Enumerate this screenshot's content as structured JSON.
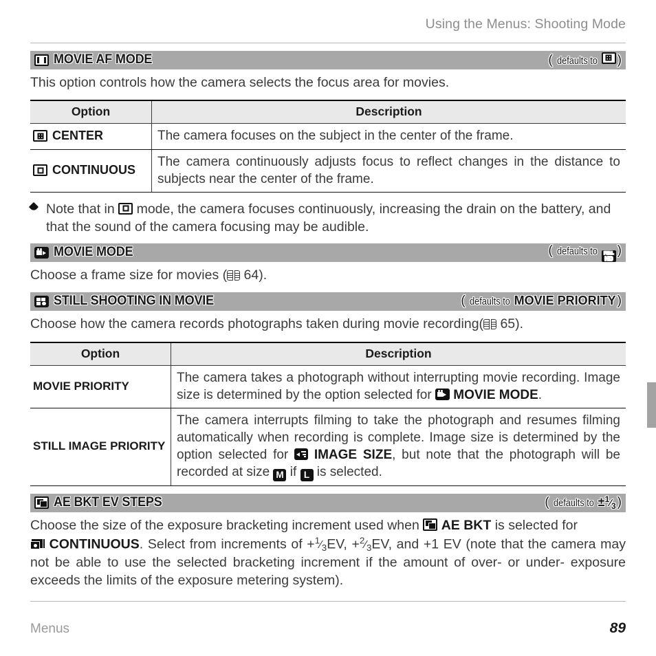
{
  "header": {
    "running_title": "Using the Menus: Shooting Mode"
  },
  "sections": {
    "movie_af": {
      "icon": "movie-af-mode-icon",
      "title": "MOVIE AF MODE",
      "defaults_prefix": "(",
      "defaults_label": "defaults to ",
      "defaults_icon": "center-af-icon",
      "defaults_suffix": ")",
      "intro": "This option controls how the camera selects the focus area for movies.",
      "table": {
        "headers": [
          "Option",
          "Description"
        ],
        "rows": [
          {
            "icon": "center-af-icon",
            "option": "CENTER",
            "description": "The camera focuses on the subject in the center of the frame."
          },
          {
            "icon": "continuous-af-icon",
            "option": "CONTINUOUS",
            "description": "The camera continuously adjusts focus to reflect changes in the distance to subjects near the center of the frame."
          }
        ]
      },
      "note": {
        "bullet_icon": "note-tag-icon",
        "text_before": "Note that in ",
        "inline_icon": "continuous-af-icon",
        "text_after": " mode, the camera focuses continuously, increasing the drain on the battery, and that the sound of the camera focusing may be audible."
      }
    },
    "movie_mode": {
      "icon": "movie-mode-icon",
      "title": "MOVIE MODE",
      "defaults_label": "defaults to ",
      "defaults_icon": "full-hd-icon",
      "defaults_icon_line1": "FULL",
      "defaults_icon_line2": "HD",
      "body_before": "Choose a frame size for movies (",
      "body_ref_icon": "page-reference-icon",
      "body_ref_page": "64",
      "body_after": ")."
    },
    "still_shooting": {
      "icon": "still-shooting-in-movie-icon",
      "title": "STILL SHOOTING IN MOVIE",
      "defaults_label": "defaults to ",
      "defaults_value": "MOVIE PRIORITY",
      "body_before": "Choose how the camera records photographs taken during movie recording(",
      "body_ref_icon": "page-reference-icon",
      "body_ref_page": "65",
      "body_after": ").",
      "table": {
        "headers": [
          "Option",
          "Description"
        ],
        "rows": [
          {
            "option": "MOVIE PRIORITY",
            "desc_part1": "The camera takes a photograph without interrupting movie recording. Image size is determined by the option selected for ",
            "inline_icon": "movie-mode-icon",
            "desc_bold": "MOVIE MODE",
            "desc_part2": "."
          },
          {
            "option": "STILL IMAGE PRIORITY",
            "desc_part1": "The camera interrupts filming to take the photograph and resumes filming automatically when recording is complete. Image size is determined by the option selected for ",
            "inline_icon": "image-size-icon",
            "desc_bold": "IMAGE SIZE",
            "desc_part2": ", but note that the photograph will be recorded at size ",
            "size_icon_m": "M",
            "desc_part3": " if ",
            "size_icon_l": "L",
            "desc_part4": " is selected."
          }
        ]
      }
    },
    "ae_bkt": {
      "icon": "ae-bkt-icon",
      "title": "AE BKT EV STEPS",
      "defaults_label": "defaults to ",
      "defaults_value_sign": "±",
      "defaults_value_frac_num": "1",
      "defaults_value_frac_den": "3",
      "body_part1": "Choose the size of the exposure bracketing increment used when ",
      "inline_icon_1": "ae-bkt-icon",
      "body_bold_1": "AE BKT",
      "body_part2": " is selected for ",
      "inline_icon_2": "continuous-shooting-icon",
      "body_bold_2": "CONTINUOUS",
      "body_part3": ". Select from increments of +",
      "frac1_num": "1",
      "frac1_den": "3",
      "body_part4": "EV, +",
      "frac2_num": "2",
      "frac2_den": "3",
      "body_part5": "EV, and +1 EV (note that the camera may not be able to use the selected bracketing increment if the amount of over- or under- exposure exceeds the limits of the exposure metering system)."
    }
  },
  "footer": {
    "chapter": "Menus",
    "page_number": "89"
  },
  "colors": {
    "bar_background": "#a8a8a8",
    "table_header_background": "#e9e9e9",
    "body_text": "#3b3b3b",
    "muted_text": "#9a9a9a",
    "rule": "#b9b9b9",
    "edge_tab": "#a3a3a3"
  }
}
